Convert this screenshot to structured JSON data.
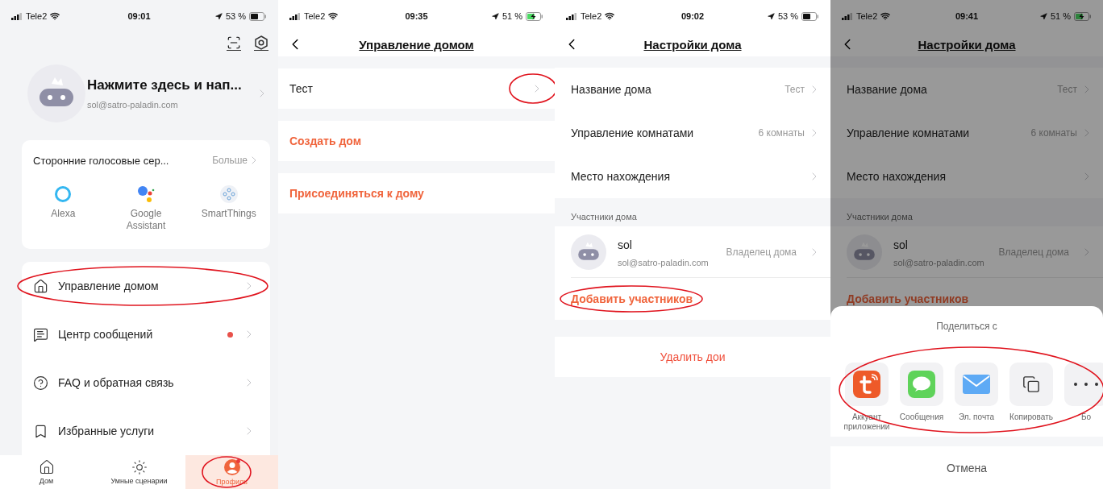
{
  "screens": [
    {
      "kind": "profile",
      "status": {
        "carrier": "Tele2",
        "time": "09:01",
        "battery": "53 %",
        "charging": false
      },
      "user": {
        "name": "Нажмите здесь и нап...",
        "email": "sol@satro-paladin.com"
      },
      "voice": {
        "title": "Сторонние голосовые сер...",
        "more": "Больше",
        "services": [
          {
            "label": "Alexa",
            "kind": "alexa"
          },
          {
            "label": "Google Assistant",
            "kind": "google"
          },
          {
            "label": "SmartThings",
            "kind": "smartthings"
          }
        ]
      },
      "menu": [
        {
          "label": "Управление домом",
          "kind": "home",
          "dot": false,
          "circled": true
        },
        {
          "label": "Центр сообщений",
          "kind": "message",
          "dot": true,
          "circled": false
        },
        {
          "label": "FAQ и обратная связь",
          "kind": "help",
          "dot": false,
          "circled": false
        },
        {
          "label": "Избранные услуги",
          "kind": "bookmark",
          "dot": false,
          "circled": false
        }
      ],
      "tabs": [
        {
          "label": "Дом",
          "kind": "home",
          "selected": false,
          "circled": false
        },
        {
          "label": "Умные сценарии",
          "kind": "scenes",
          "selected": false,
          "circled": false
        },
        {
          "label": "Профиль",
          "kind": "profile",
          "selected": true,
          "circled": true
        }
      ]
    },
    {
      "kind": "home_list",
      "status": {
        "carrier": "Tele2",
        "time": "09:35",
        "battery": "51 %",
        "charging": true
      },
      "title": "Управление домом",
      "homes": [
        {
          "label": "Тест",
          "circled": true
        }
      ],
      "actions": [
        "Создать дом",
        "Присоединяться к дому"
      ]
    },
    {
      "kind": "home_settings",
      "status": {
        "carrier": "Tele2",
        "time": "09:02",
        "battery": "53 %",
        "charging": false
      },
      "title": "Настройки дома",
      "dimmed": false,
      "rows": [
        {
          "label": "Название дома",
          "value": "Тест"
        },
        {
          "label": "Управление комнатами",
          "value": "6 комнаты"
        },
        {
          "label": "Место нахождения"
        }
      ],
      "section": "Участники дома",
      "members": [
        {
          "name": "sol",
          "email": "sol@satro-paladin.com",
          "role": "Владелец дома"
        }
      ],
      "add": {
        "label": "Добавить участников",
        "circled": true
      },
      "delete": "Удалить дои"
    },
    {
      "kind": "home_settings",
      "status": {
        "carrier": "Tele2",
        "time": "09:41",
        "battery": "51 %",
        "charging": true
      },
      "title": "Настройки дома",
      "dimmed": true,
      "rows": [
        {
          "label": "Название дома",
          "value": "Тест"
        },
        {
          "label": "Управление комнатами",
          "value": "6 комнаты"
        },
        {
          "label": "Место нахождения"
        }
      ],
      "section": "Участники дома",
      "members": [
        {
          "name": "sol",
          "email": "sol@satro-paladin.com",
          "role": "Владелец дома"
        }
      ],
      "add": {
        "label": "Добавить участников",
        "circled": false
      },
      "share": {
        "title": "Поделиться с",
        "circled": true,
        "cancel": "Отмена",
        "options": [
          {
            "label": "Аккуант приложении",
            "kind": "app"
          },
          {
            "label": "Сообщения",
            "kind": "messages"
          },
          {
            "label": "Эл. почта",
            "kind": "mail"
          },
          {
            "label": "Копировать",
            "kind": "copy"
          },
          {
            "label": "Бо",
            "kind": "more"
          }
        ]
      }
    }
  ]
}
